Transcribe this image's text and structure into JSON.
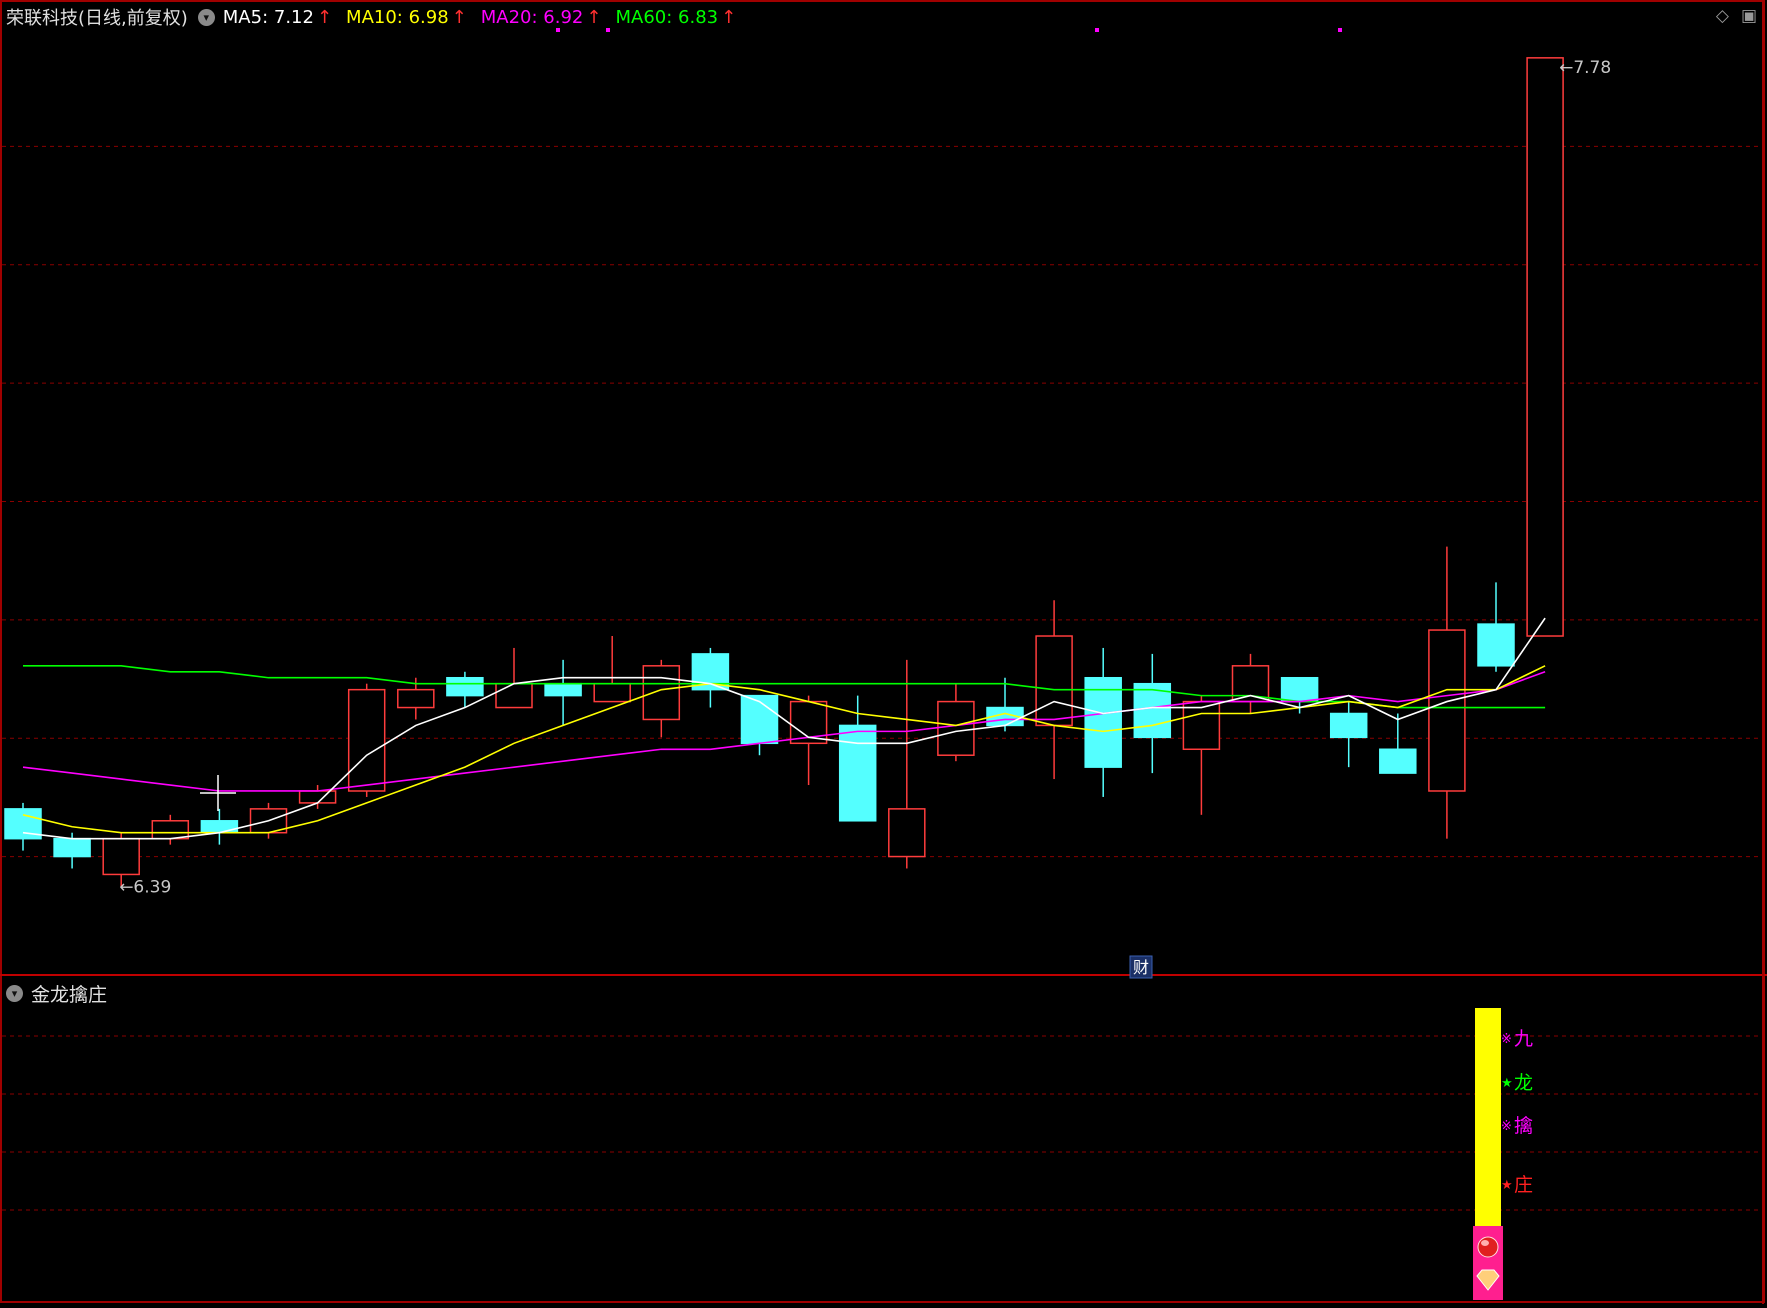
{
  "title": "荣联科技(日线,前复权)",
  "toggle_icon": "chevron-down-icon",
  "indicators": [
    {
      "label": "MA5: 7.12",
      "color": "#ffffff",
      "arrow": "↑"
    },
    {
      "label": "MA10: 6.98",
      "color": "#ffff00",
      "arrow": "↑"
    },
    {
      "label": "MA20: 6.92",
      "color": "#ff00ff",
      "arrow": "↑"
    },
    {
      "label": "MA60: 6.83",
      "color": "#00ff00",
      "arrow": "↑"
    }
  ],
  "arrow_color": "#ff3030",
  "top_right_icons": [
    "diamond-icon",
    "window-icon"
  ],
  "fin_badge": "财",
  "sub_panel": {
    "title": "金龙擒庄",
    "signals": [
      {
        "char": "九",
        "marker": "※",
        "color": "#ff00ff"
      },
      {
        "char": "龙",
        "marker": "★",
        "color": "#00ff00"
      },
      {
        "char": "擒",
        "marker": "※",
        "color": "#ff00ff"
      },
      {
        "char": "庄",
        "marker": "★",
        "color": "#ff2020"
      }
    ],
    "bar_color": "#ffff00",
    "bar_base_color": "#ff1f8f",
    "base_icons": [
      "ball-icon",
      "gem-icon"
    ]
  },
  "chart_data": {
    "type": "candlestick",
    "ylim": [
      6.3,
      7.82
    ],
    "grid": true,
    "high_label": "7.78",
    "low_label": "6.39",
    "colors": {
      "up": "#ff3c3c",
      "down": "#54ffff",
      "grid": "#8a0000",
      "ma5": "#ffffff",
      "ma10": "#ffff00",
      "ma20": "#ff00ff",
      "ma60": "#00ff00"
    },
    "candles": [
      {
        "o": 6.52,
        "h": 6.53,
        "l": 6.45,
        "c": 6.47
      },
      {
        "o": 6.47,
        "h": 6.48,
        "l": 6.42,
        "c": 6.44
      },
      {
        "o": 6.41,
        "h": 6.48,
        "l": 6.39,
        "c": 6.47
      },
      {
        "o": 6.47,
        "h": 6.51,
        "l": 6.46,
        "c": 6.5
      },
      {
        "o": 6.5,
        "h": 6.52,
        "l": 6.46,
        "c": 6.48
      },
      {
        "o": 6.48,
        "h": 6.53,
        "l": 6.47,
        "c": 6.52
      },
      {
        "o": 6.53,
        "h": 6.56,
        "l": 6.52,
        "c": 6.55
      },
      {
        "o": 6.55,
        "h": 6.73,
        "l": 6.54,
        "c": 6.72
      },
      {
        "o": 6.69,
        "h": 6.74,
        "l": 6.67,
        "c": 6.72
      },
      {
        "o": 6.74,
        "h": 6.75,
        "l": 6.69,
        "c": 6.71
      },
      {
        "o": 6.69,
        "h": 6.79,
        "l": 6.69,
        "c": 6.73
      },
      {
        "o": 6.73,
        "h": 6.77,
        "l": 6.66,
        "c": 6.71
      },
      {
        "o": 6.7,
        "h": 6.81,
        "l": 6.7,
        "c": 6.73
      },
      {
        "o": 6.67,
        "h": 6.77,
        "l": 6.64,
        "c": 6.76
      },
      {
        "o": 6.78,
        "h": 6.79,
        "l": 6.69,
        "c": 6.72
      },
      {
        "o": 6.71,
        "h": 6.71,
        "l": 6.61,
        "c": 6.63
      },
      {
        "o": 6.63,
        "h": 6.71,
        "l": 6.56,
        "c": 6.7
      },
      {
        "o": 6.66,
        "h": 6.71,
        "l": 6.53,
        "c": 6.5
      },
      {
        "o": 6.44,
        "h": 6.77,
        "l": 6.42,
        "c": 6.52
      },
      {
        "o": 6.61,
        "h": 6.73,
        "l": 6.6,
        "c": 6.7
      },
      {
        "o": 6.69,
        "h": 6.74,
        "l": 6.65,
        "c": 6.66
      },
      {
        "o": 6.66,
        "h": 6.87,
        "l": 6.57,
        "c": 6.81
      },
      {
        "o": 6.74,
        "h": 6.79,
        "l": 6.54,
        "c": 6.59
      },
      {
        "o": 6.73,
        "h": 6.78,
        "l": 6.58,
        "c": 6.64
      },
      {
        "o": 6.62,
        "h": 6.71,
        "l": 6.51,
        "c": 6.7
      },
      {
        "o": 6.7,
        "h": 6.78,
        "l": 6.68,
        "c": 6.76
      },
      {
        "o": 6.74,
        "h": 6.74,
        "l": 6.68,
        "c": 6.7
      },
      {
        "o": 6.68,
        "h": 6.7,
        "l": 6.59,
        "c": 6.64
      },
      {
        "o": 6.62,
        "h": 6.68,
        "l": 6.62,
        "c": 6.58
      },
      {
        "o": 6.55,
        "h": 6.96,
        "l": 6.47,
        "c": 6.82
      },
      {
        "o": 6.83,
        "h": 6.9,
        "l": 6.75,
        "c": 6.76
      },
      {
        "o": 6.81,
        "h": 7.78,
        "l": 6.81,
        "c": 7.78
      }
    ],
    "ma5": [
      6.48,
      6.47,
      6.47,
      6.47,
      6.48,
      6.5,
      6.53,
      6.61,
      6.66,
      6.69,
      6.73,
      6.74,
      6.74,
      6.74,
      6.73,
      6.7,
      6.64,
      6.63,
      6.63,
      6.65,
      6.66,
      6.7,
      6.68,
      6.69,
      6.69,
      6.71,
      6.69,
      6.71,
      6.67,
      6.7,
      6.72,
      6.84
    ],
    "ma10": [
      6.51,
      6.49,
      6.48,
      6.48,
      6.48,
      6.48,
      6.5,
      6.53,
      6.56,
      6.59,
      6.63,
      6.66,
      6.69,
      6.72,
      6.73,
      6.72,
      6.7,
      6.68,
      6.67,
      6.66,
      6.68,
      6.66,
      6.65,
      6.66,
      6.68,
      6.68,
      6.69,
      6.7,
      6.69,
      6.72,
      6.72,
      6.76
    ],
    "ma20": [
      6.59,
      6.58,
      6.57,
      6.56,
      6.55,
      6.55,
      6.55,
      6.56,
      6.57,
      6.58,
      6.59,
      6.6,
      6.61,
      6.62,
      6.62,
      6.63,
      6.64,
      6.65,
      6.65,
      6.66,
      6.67,
      6.67,
      6.68,
      6.69,
      6.7,
      6.7,
      6.7,
      6.71,
      6.7,
      6.71,
      6.72,
      6.75
    ],
    "ma60": [
      6.76,
      6.76,
      6.76,
      6.75,
      6.75,
      6.74,
      6.74,
      6.74,
      6.73,
      6.73,
      6.73,
      6.73,
      6.73,
      6.73,
      6.73,
      6.73,
      6.73,
      6.73,
      6.73,
      6.73,
      6.73,
      6.72,
      6.72,
      6.72,
      6.71,
      6.71,
      6.7,
      6.7,
      6.69,
      6.69,
      6.69,
      6.69
    ]
  }
}
